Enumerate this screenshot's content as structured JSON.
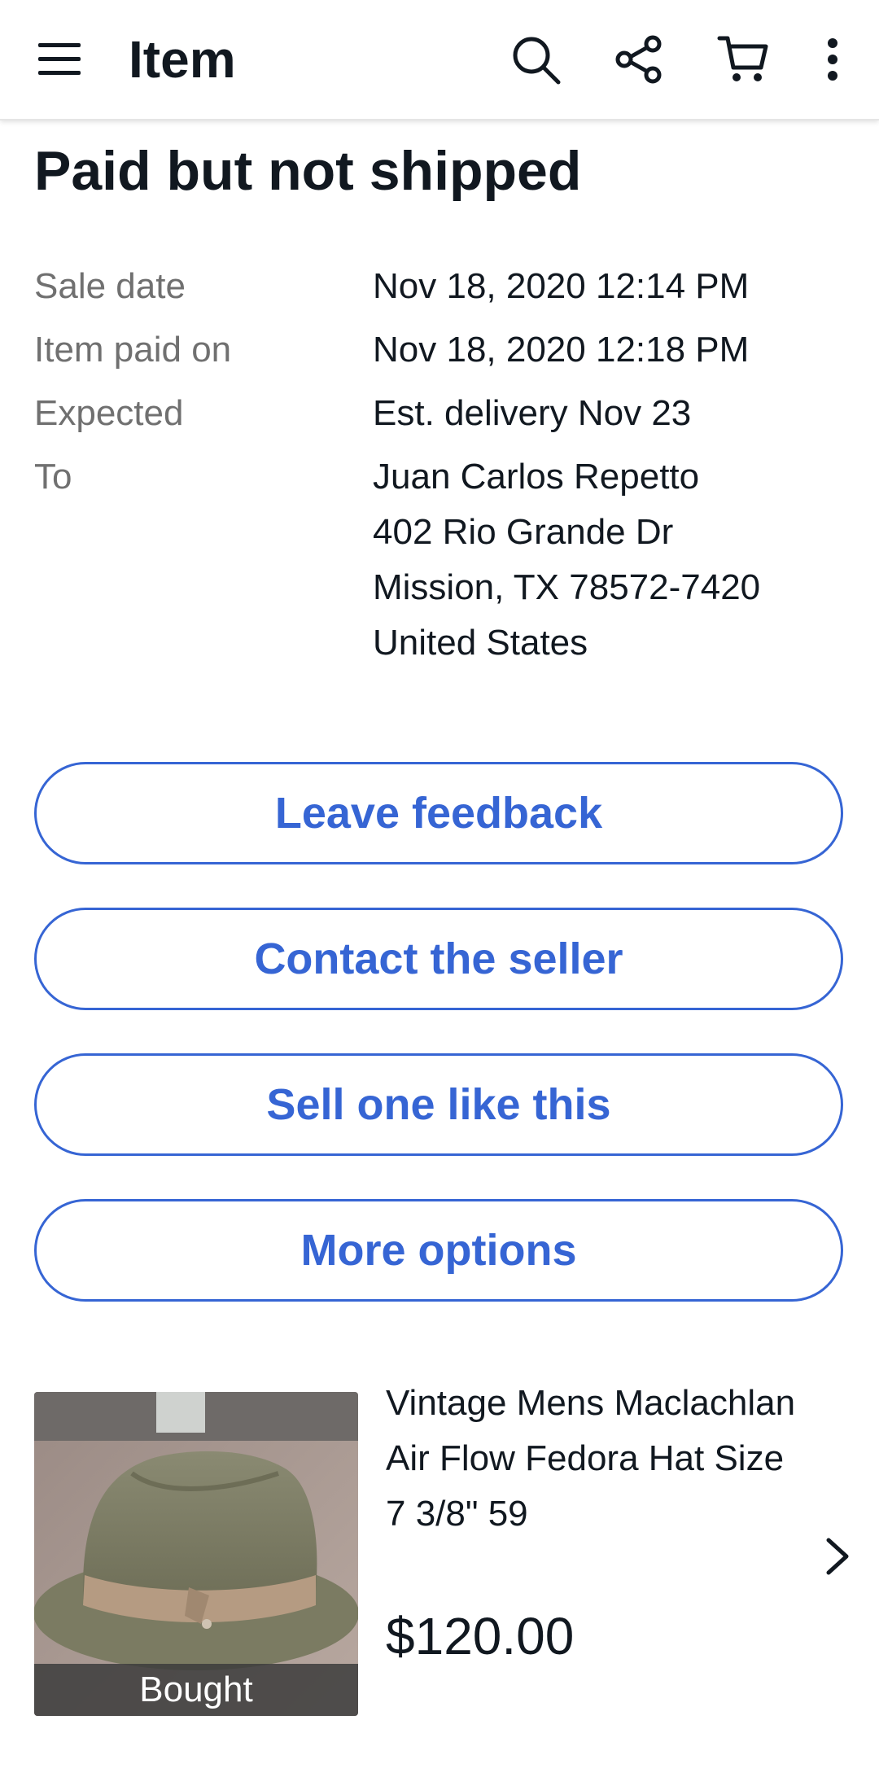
{
  "appbar": {
    "title": "Item",
    "icons": [
      "menu-icon",
      "search-icon",
      "share-icon",
      "cart-icon",
      "more-vert-icon"
    ]
  },
  "order": {
    "status": "Paid but not shipped",
    "rows": [
      {
        "label": "Sale date",
        "value": "Nov 18, 2020 12:14 PM"
      },
      {
        "label": "Item paid on",
        "value": "Nov 18, 2020 12:18 PM"
      },
      {
        "label": "Expected",
        "value": "Est. delivery Nov 23"
      }
    ],
    "to_label": "To",
    "address": [
      "Juan Carlos Repetto",
      "402 Rio Grande Dr",
      "Mission, TX 78572-7420",
      "United States"
    ]
  },
  "actions": {
    "leave_feedback": "Leave feedback",
    "contact_seller": "Contact the seller",
    "sell_one": "Sell one like this",
    "more_options": "More options"
  },
  "item": {
    "title": "Vintage Mens Maclachlan Air Flow Fedora Hat Size 7 3/8\" 59",
    "price": "$120.00",
    "badge": "Bought"
  },
  "colors": {
    "accent": "#3665d4",
    "label_gray": "#707070",
    "text": "#111820"
  }
}
